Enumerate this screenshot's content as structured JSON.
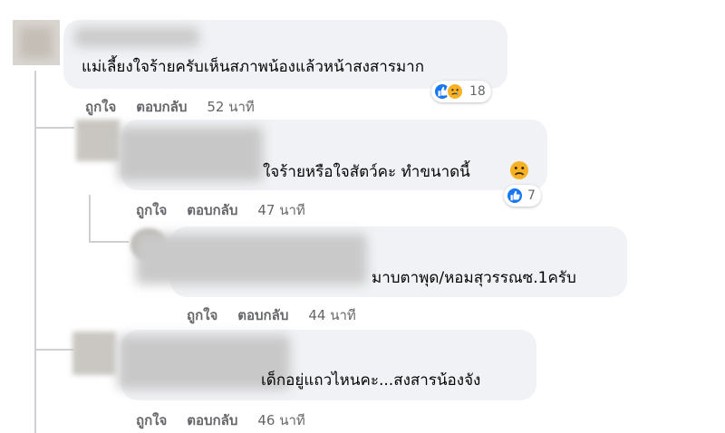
{
  "comments": [
    {
      "text": "แม่เลี้ยงใจร้ายครับเห็นสภาพน้องแล้วหน้าสงสารมาก",
      "actions": {
        "like": "ถูกใจ",
        "reply": "ตอบกลับ",
        "time": "52 นาที"
      },
      "reactions": {
        "count": "18",
        "icons": [
          "like-icon",
          "sad-icon"
        ]
      }
    },
    {
      "text": "ใจร้ายหรือใจสัตว์คะ  ทำขนาดนี้",
      "actions": {
        "like": "ถูกใจ",
        "reply": "ตอบกลับ",
        "time": "47 นาที"
      },
      "reactions": {
        "count": "7",
        "icons": [
          "like-icon"
        ]
      },
      "inline_emoji": "sad-face-emoji-icon"
    },
    {
      "text": "มาบตาพุด/หอมสุวรรณซ.1ครับ",
      "actions": {
        "like": "ถูกใจ",
        "reply": "ตอบกลับ",
        "time": "44 นาที"
      }
    },
    {
      "text": "เด็กอยู่แถวไหนคะ...สงสารน้องจัง",
      "actions": {
        "like": "ถูกใจ",
        "reply": "ตอบกลับ",
        "time": "46 นาที"
      }
    }
  ],
  "colors": {
    "bubble": "#f0f2f5",
    "like": "#1877f2",
    "sad": "#f7b125",
    "meta": "#65676b"
  }
}
